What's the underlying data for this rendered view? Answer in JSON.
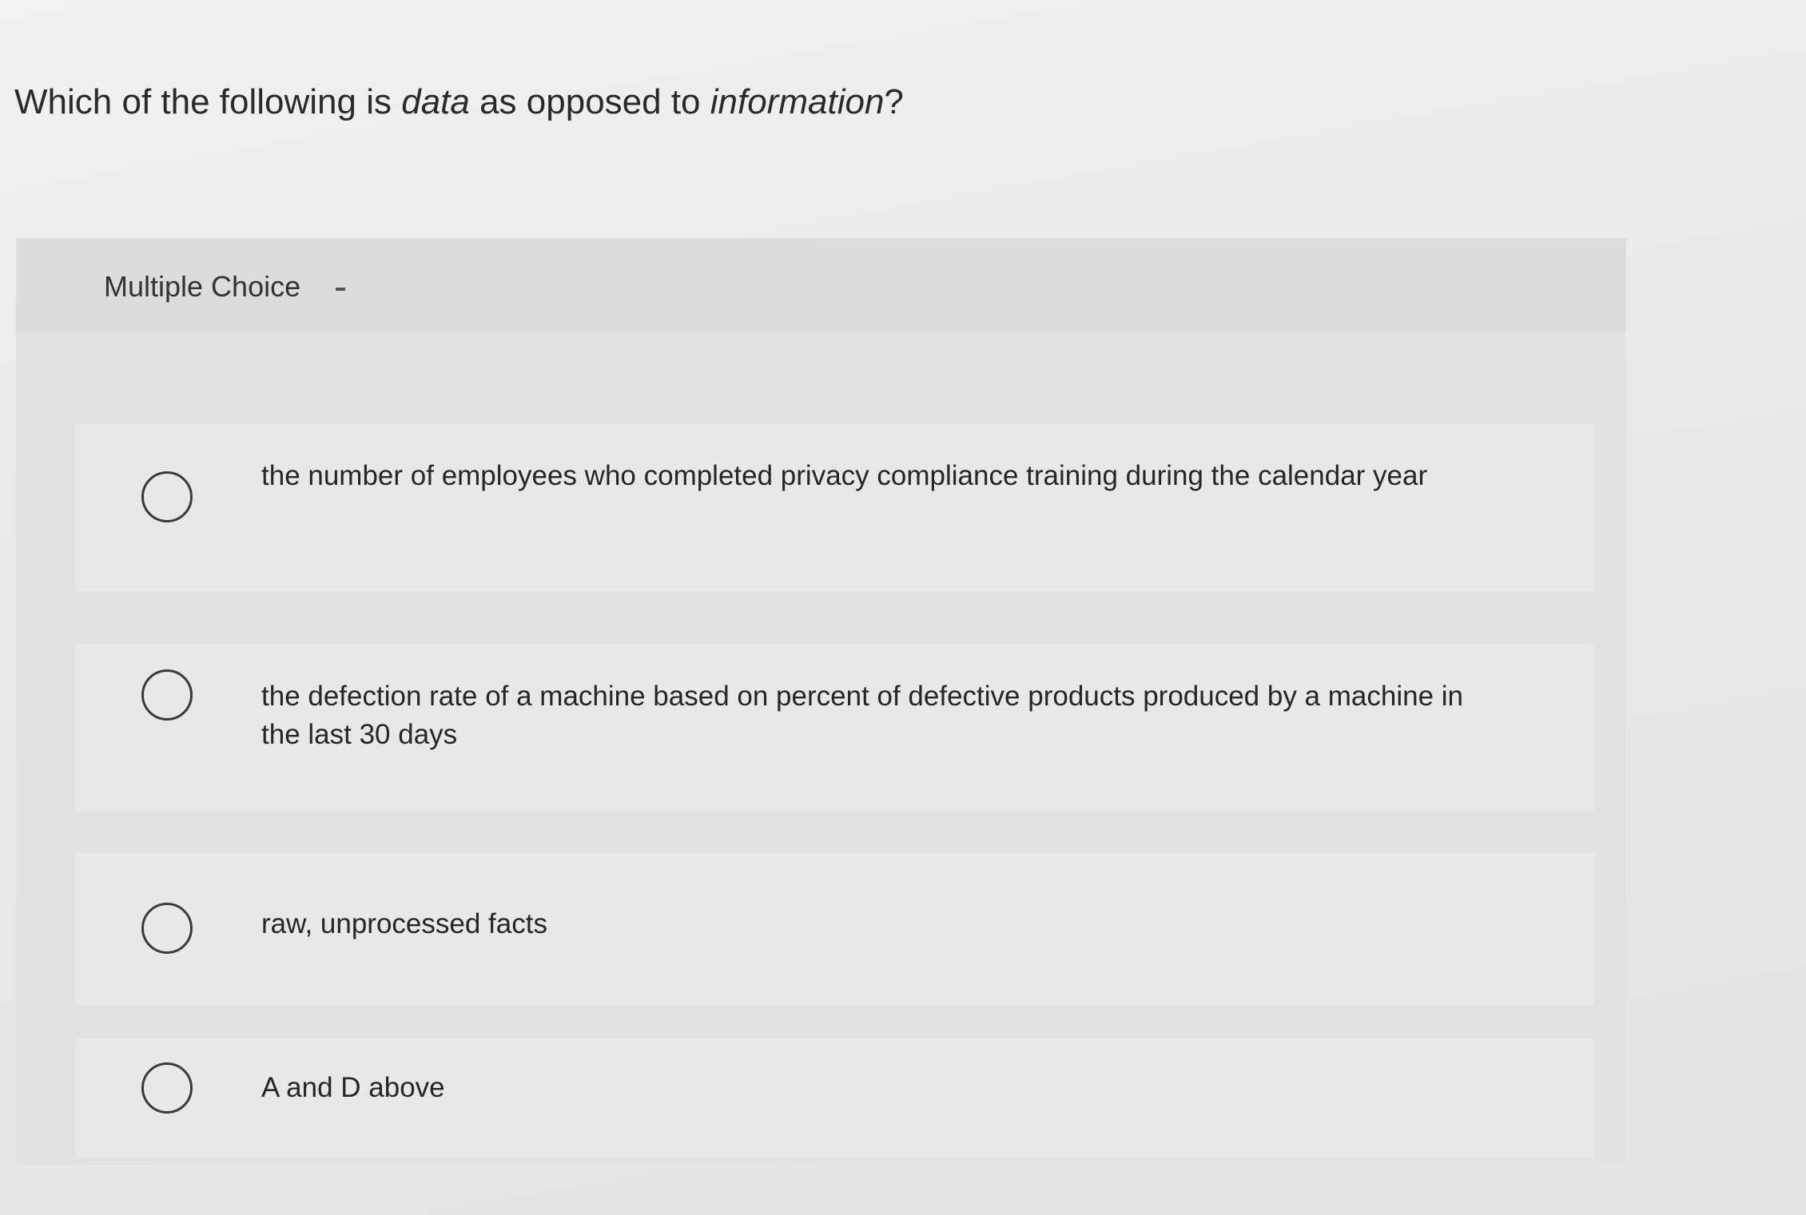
{
  "question": {
    "prefix": "Which of the following is ",
    "term1": "data",
    "middle": " as opposed to ",
    "term2": "information",
    "suffix": "?"
  },
  "section": {
    "label": "Multiple Choice"
  },
  "options": [
    {
      "text": "the number of employees who completed privacy compliance training during the calendar year"
    },
    {
      "text": "the defection rate of a machine based on percent of defective products produced by a machine in the last 30 days"
    },
    {
      "text": "raw, unprocessed facts"
    },
    {
      "text": "A and D above"
    }
  ]
}
